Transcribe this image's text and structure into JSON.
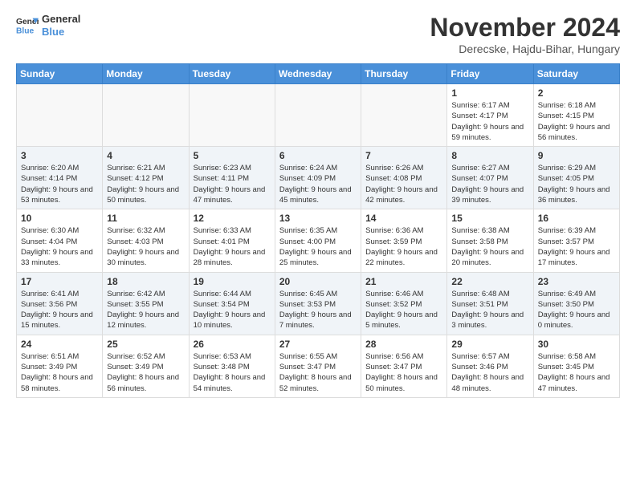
{
  "header": {
    "logo_line1": "General",
    "logo_line2": "Blue",
    "main_title": "November 2024",
    "subtitle": "Derecske, Hajdu-Bihar, Hungary"
  },
  "days_of_week": [
    "Sunday",
    "Monday",
    "Tuesday",
    "Wednesday",
    "Thursday",
    "Friday",
    "Saturday"
  ],
  "weeks": [
    [
      {
        "day": "",
        "content": ""
      },
      {
        "day": "",
        "content": ""
      },
      {
        "day": "",
        "content": ""
      },
      {
        "day": "",
        "content": ""
      },
      {
        "day": "",
        "content": ""
      },
      {
        "day": "1",
        "content": "Sunrise: 6:17 AM\nSunset: 4:17 PM\nDaylight: 9 hours and 59 minutes."
      },
      {
        "day": "2",
        "content": "Sunrise: 6:18 AM\nSunset: 4:15 PM\nDaylight: 9 hours and 56 minutes."
      }
    ],
    [
      {
        "day": "3",
        "content": "Sunrise: 6:20 AM\nSunset: 4:14 PM\nDaylight: 9 hours and 53 minutes."
      },
      {
        "day": "4",
        "content": "Sunrise: 6:21 AM\nSunset: 4:12 PM\nDaylight: 9 hours and 50 minutes."
      },
      {
        "day": "5",
        "content": "Sunrise: 6:23 AM\nSunset: 4:11 PM\nDaylight: 9 hours and 47 minutes."
      },
      {
        "day": "6",
        "content": "Sunrise: 6:24 AM\nSunset: 4:09 PM\nDaylight: 9 hours and 45 minutes."
      },
      {
        "day": "7",
        "content": "Sunrise: 6:26 AM\nSunset: 4:08 PM\nDaylight: 9 hours and 42 minutes."
      },
      {
        "day": "8",
        "content": "Sunrise: 6:27 AM\nSunset: 4:07 PM\nDaylight: 9 hours and 39 minutes."
      },
      {
        "day": "9",
        "content": "Sunrise: 6:29 AM\nSunset: 4:05 PM\nDaylight: 9 hours and 36 minutes."
      }
    ],
    [
      {
        "day": "10",
        "content": "Sunrise: 6:30 AM\nSunset: 4:04 PM\nDaylight: 9 hours and 33 minutes."
      },
      {
        "day": "11",
        "content": "Sunrise: 6:32 AM\nSunset: 4:03 PM\nDaylight: 9 hours and 30 minutes."
      },
      {
        "day": "12",
        "content": "Sunrise: 6:33 AM\nSunset: 4:01 PM\nDaylight: 9 hours and 28 minutes."
      },
      {
        "day": "13",
        "content": "Sunrise: 6:35 AM\nSunset: 4:00 PM\nDaylight: 9 hours and 25 minutes."
      },
      {
        "day": "14",
        "content": "Sunrise: 6:36 AM\nSunset: 3:59 PM\nDaylight: 9 hours and 22 minutes."
      },
      {
        "day": "15",
        "content": "Sunrise: 6:38 AM\nSunset: 3:58 PM\nDaylight: 9 hours and 20 minutes."
      },
      {
        "day": "16",
        "content": "Sunrise: 6:39 AM\nSunset: 3:57 PM\nDaylight: 9 hours and 17 minutes."
      }
    ],
    [
      {
        "day": "17",
        "content": "Sunrise: 6:41 AM\nSunset: 3:56 PM\nDaylight: 9 hours and 15 minutes."
      },
      {
        "day": "18",
        "content": "Sunrise: 6:42 AM\nSunset: 3:55 PM\nDaylight: 9 hours and 12 minutes."
      },
      {
        "day": "19",
        "content": "Sunrise: 6:44 AM\nSunset: 3:54 PM\nDaylight: 9 hours and 10 minutes."
      },
      {
        "day": "20",
        "content": "Sunrise: 6:45 AM\nSunset: 3:53 PM\nDaylight: 9 hours and 7 minutes."
      },
      {
        "day": "21",
        "content": "Sunrise: 6:46 AM\nSunset: 3:52 PM\nDaylight: 9 hours and 5 minutes."
      },
      {
        "day": "22",
        "content": "Sunrise: 6:48 AM\nSunset: 3:51 PM\nDaylight: 9 hours and 3 minutes."
      },
      {
        "day": "23",
        "content": "Sunrise: 6:49 AM\nSunset: 3:50 PM\nDaylight: 9 hours and 0 minutes."
      }
    ],
    [
      {
        "day": "24",
        "content": "Sunrise: 6:51 AM\nSunset: 3:49 PM\nDaylight: 8 hours and 58 minutes."
      },
      {
        "day": "25",
        "content": "Sunrise: 6:52 AM\nSunset: 3:49 PM\nDaylight: 8 hours and 56 minutes."
      },
      {
        "day": "26",
        "content": "Sunrise: 6:53 AM\nSunset: 3:48 PM\nDaylight: 8 hours and 54 minutes."
      },
      {
        "day": "27",
        "content": "Sunrise: 6:55 AM\nSunset: 3:47 PM\nDaylight: 8 hours and 52 minutes."
      },
      {
        "day": "28",
        "content": "Sunrise: 6:56 AM\nSunset: 3:47 PM\nDaylight: 8 hours and 50 minutes."
      },
      {
        "day": "29",
        "content": "Sunrise: 6:57 AM\nSunset: 3:46 PM\nDaylight: 8 hours and 48 minutes."
      },
      {
        "day": "30",
        "content": "Sunrise: 6:58 AM\nSunset: 3:45 PM\nDaylight: 8 hours and 47 minutes."
      }
    ]
  ]
}
